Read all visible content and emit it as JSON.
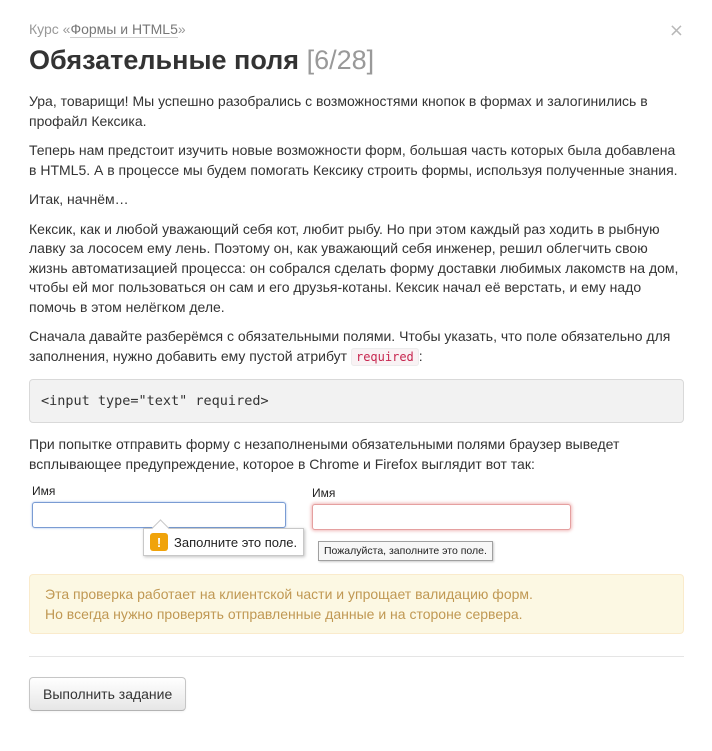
{
  "close_icon": "×",
  "breadcrumb": {
    "prefix": "Курс «",
    "link": "Формы и HTML5",
    "suffix": "»"
  },
  "title": {
    "text": "Обязательные поля",
    "counter": "[6/28]"
  },
  "paragraphs": {
    "p1": "Ура, товарищи! Мы успешно разобрались с возможностями кнопок в формах и залогинились в профайл Кексика.",
    "p2": "Теперь нам предстоит изучить новые возможности форм, большая часть которых была добавлена в HTML5. А в процессе мы будем помогать Кексику строить формы, используя полученные знания.",
    "p3": "Итак, начнём…",
    "p4": "Кексик, как и любой уважающий себя кот, любит рыбу. Но при этом каждый раз ходить в рыбную лавку за лососем ему лень. Поэтому он, как уважающий себя инженер, решил облегчить свою жизнь автоматизацией процесса: он собрался сделать форму доставки любимых лакомств на дом, чтобы ей мог пользоваться он сам и его друзья-котаны. Кексик начал её верстать, и ему надо помочь в этом нелёгком деле.",
    "p5_before": "Сначала давайте разберёмся с обязательными полями. Чтобы указать, что поле обязательно для заполнения, нужно добавить ему пустой атрибут ",
    "p5_code": "required",
    "p5_after": ":",
    "p6": "При попытке отправить форму с незаполнеными обязательными полями браузер выведет всплывающее предупреждение, которое в Chrome и Firefox выглядит вот так:"
  },
  "code_block": "<input type=\"text\" required>",
  "demo": {
    "chrome_label": "Имя",
    "chrome_tooltip": "Заполните это поле.",
    "chrome_warn_icon": "!",
    "firefox_label": "Имя",
    "firefox_tooltip": "Пожалуйста, заполните это поле."
  },
  "notice": {
    "line1": "Эта проверка работает на клиентской части и упрощает валидацию форм.",
    "line2": "Но всегда нужно проверять отправленные данные и на стороне сервера."
  },
  "button": {
    "label": "Выполнить задание"
  },
  "colors": {
    "notice_bg": "#fcf8e3",
    "notice_text": "#c09853",
    "code_inline": "#c7254e",
    "chrome_focus": "#7a9cd3",
    "firefox_invalid": "#e5a0a0",
    "warn": "#f0a30a"
  }
}
